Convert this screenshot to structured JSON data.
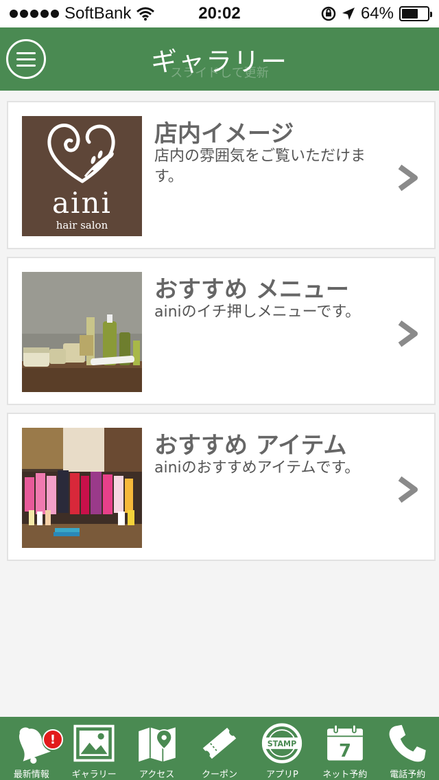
{
  "status_bar": {
    "carrier": "SoftBank",
    "time": "20:02",
    "battery_percent": "64%",
    "battery_level": 0.64
  },
  "header": {
    "title": "ギャラリー",
    "subtitle": "スライドして更新"
  },
  "gallery": {
    "items": [
      {
        "title": "店内イメージ",
        "description": "店内の雰囲気をご覧いただけます。",
        "thumbnail": "aini-logo"
      },
      {
        "title": "おすすめ メニュー",
        "description": "ainiのイチ押しメニューです。",
        "thumbnail": "menu-products-photo"
      },
      {
        "title": "おすすめ アイテム",
        "description": "ainiのおすすめアイテムです。",
        "thumbnail": "items-products-photo"
      }
    ],
    "logo_text": "aini",
    "logo_subtext": "hair salon"
  },
  "tabbar": {
    "badge": "!",
    "items": [
      {
        "label": "最新情報",
        "icon": "bell-icon"
      },
      {
        "label": "ギャラリー",
        "icon": "image-icon"
      },
      {
        "label": "アクセス",
        "icon": "map-icon"
      },
      {
        "label": "クーポン",
        "icon": "ticket-icon"
      },
      {
        "label": "アプリP",
        "icon": "stamp-icon"
      },
      {
        "label": "ネット予約",
        "icon": "calendar-icon"
      },
      {
        "label": "電話予約",
        "icon": "phone-icon"
      }
    ],
    "calendar_day": "7",
    "stamp_text": "STAMP"
  },
  "colors": {
    "brand_green": "#4a8a52",
    "logo_brown": "#5e4638",
    "badge_red": "#e21b1b"
  }
}
